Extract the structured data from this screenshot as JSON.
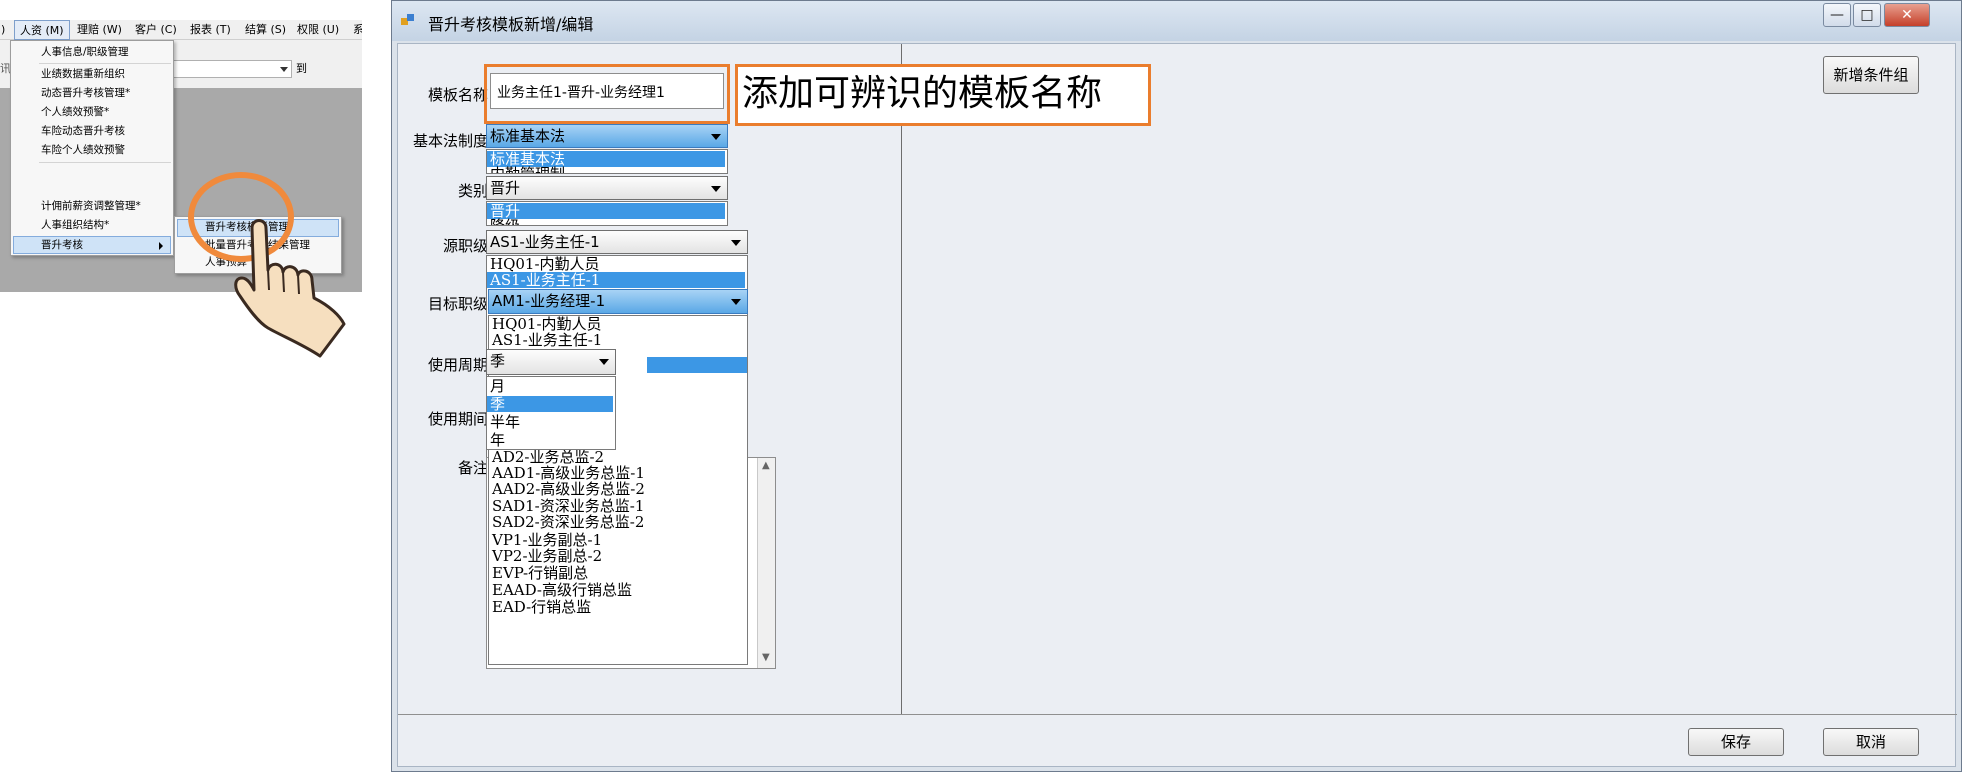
{
  "tutorial": {
    "menubar": [
      "人资 (M)",
      "理赔 (W)",
      "客户 (C)",
      "报表 (T)",
      "结算 (S)",
      "权限 (U)",
      "系"
    ],
    "toolbar_label": "讯",
    "toolbar_to": "到",
    "menu_items": [
      "人事信息/职级管理",
      "业绩数据重新组织",
      "动态晋升考核管理*",
      "个人绩效预警*",
      "车险动态晋升考核",
      "车险个人绩效预警",
      "计佣前薪资调整管理*",
      "人事组织结构*",
      "晋升考核"
    ],
    "submenu_items": [
      "晋升考核模板管理",
      "批量晋升考核结果管理",
      "人事预算"
    ]
  },
  "window": {
    "title": "晋升考核模板新增/编辑",
    "minimize": "—",
    "maximize": "□",
    "close": "✕"
  },
  "form": {
    "template_name_label": "模板名称",
    "template_name_value": "业务主任1-晋升-业务经理1",
    "base_law_label": "基本法制度",
    "base_law_value": "标准基本法",
    "base_law_options": [
      "标准基本法",
      "内勤管理制"
    ],
    "type_label": "类别",
    "type_value": "晋升",
    "type_options": [
      "晋升",
      "降级"
    ],
    "source_level_label": "源职级",
    "source_level_value": "AS1-业务主任-1",
    "source_level_options": [
      "HQ01-内勤人员",
      "AS1-业务主任-1"
    ],
    "target_level_label": "目标职级",
    "target_level_value": "AM1-业务经理-1",
    "target_level_options": [
      "HQ01-内勤人员",
      "AS1-业务主任-1",
      "AD2-业务总监-2",
      "AAD1-高级业务总监-1",
      "AAD2-高级业务总监-2",
      "SAD1-资深业务总监-1",
      "SAD2-资深业务总监-2",
      "VP1-业务副总-1",
      "VP2-业务副总-2",
      "EVP-行销副总",
      "EAAD-高级行销总监",
      "EAD-行销总监"
    ],
    "period_label": "使用周期",
    "period_value": "季",
    "period_options": [
      "月",
      "季",
      "半年",
      "年"
    ],
    "usage_period_label": "使用期间",
    "remark_label": "备注"
  },
  "callout_text": "添加可辨识的模板名称",
  "buttons": {
    "add_group": "新增条件组",
    "save": "保存",
    "cancel": "取消"
  },
  "colors": {
    "callout_border": "#ea7d2d",
    "selection": "#3c97e5",
    "combo_selected": "#5aa8e6"
  }
}
